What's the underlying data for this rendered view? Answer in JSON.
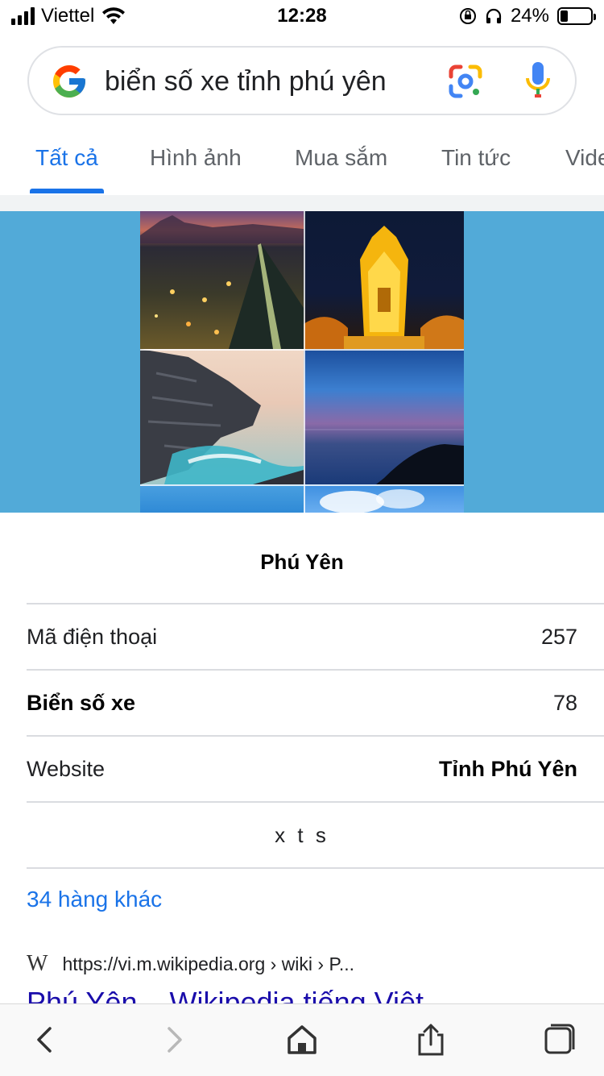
{
  "status_bar": {
    "carrier": "Viettel",
    "time": "12:28",
    "battery_percent": "24%",
    "battery_level": 0.24,
    "icons": [
      "signal-icon",
      "wifi-icon",
      "orientation-lock-icon",
      "headphones-icon",
      "battery-icon"
    ]
  },
  "search": {
    "query": "biển số xe tỉnh phú yên",
    "icons": [
      "google-logo-icon",
      "google-lens-icon",
      "microphone-icon"
    ]
  },
  "tabs": [
    {
      "label": "Tất cả",
      "active": true
    },
    {
      "label": "Hình ảnh",
      "active": false
    },
    {
      "label": "Mua sắm",
      "active": false
    },
    {
      "label": "Tin tức",
      "active": false
    },
    {
      "label": "Video",
      "active": false
    }
  ],
  "knowledge_card": {
    "title": "Phú Yên",
    "rows": [
      {
        "key": "Mã điện thoại",
        "value": "257"
      },
      {
        "key": "Biển số xe",
        "value": "78"
      },
      {
        "key": "Website",
        "value": "Tỉnh Phú Yên"
      },
      {
        "text": "x t s"
      }
    ],
    "more_link": "34 hàng khác"
  },
  "result": {
    "source_icon": "W",
    "url": "https://vi.m.wikipedia.org › wiki › P...",
    "title": "Phú Yên – Wikipedia tiếng Việt"
  },
  "toolbar": {
    "icons": [
      "back-icon",
      "forward-icon",
      "home-icon",
      "share-icon",
      "tabs-icon"
    ]
  },
  "colors": {
    "accent": "#1a73e8",
    "panel_bg": "#52aad8"
  }
}
